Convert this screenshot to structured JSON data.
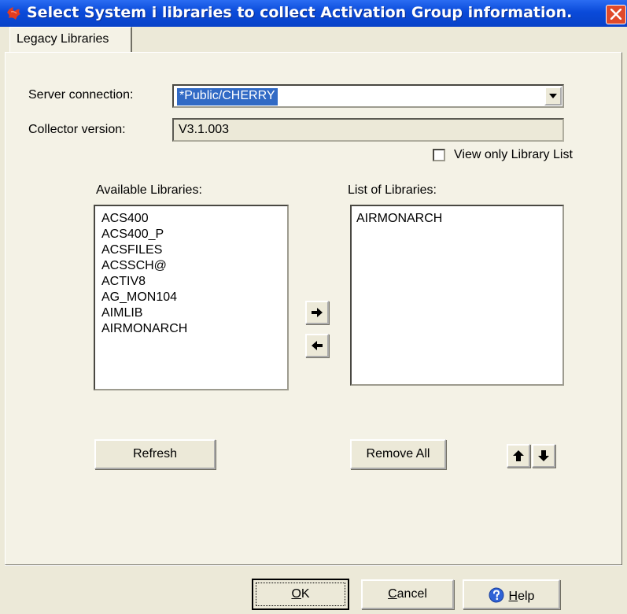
{
  "window": {
    "title": "Select System i libraries to collect Activation Group information.",
    "title_bar_color": "#0a4ad9",
    "close_color": "#e04a2a"
  },
  "tabs": [
    {
      "label": "Legacy Libraries",
      "selected": true
    }
  ],
  "form": {
    "server_connection_label": "Server connection:",
    "server_connection_value": "*Public/CHERRY",
    "collector_version_label": "Collector version:",
    "collector_version_value": "V3.1.003",
    "view_only_label": "View only Library List",
    "view_only_checked": false
  },
  "available": {
    "label": "Available Libraries:",
    "items": [
      "ACS400",
      "ACS400_P",
      "ACSFILES",
      "ACSSCH@",
      "ACTIV8",
      "AG_MON104",
      "AIMLIB",
      "AIRMONARCH"
    ]
  },
  "selected_list": {
    "label": "List of Libraries:",
    "items": [
      "AIRMONARCH"
    ]
  },
  "buttons": {
    "refresh": "Refresh",
    "remove_all": "Remove All",
    "ok_mnemonic": "O",
    "ok_rest": "K",
    "cancel_mnemonic": "C",
    "cancel_rest": "ancel",
    "help_mnemonic": "H",
    "help_rest": "elp"
  },
  "icons": [
    "java-cup-icon",
    "close-icon",
    "dropdown-arrow-icon",
    "arrow-right-icon",
    "arrow-left-icon",
    "arrow-up-icon",
    "arrow-down-icon",
    "help-icon"
  ]
}
